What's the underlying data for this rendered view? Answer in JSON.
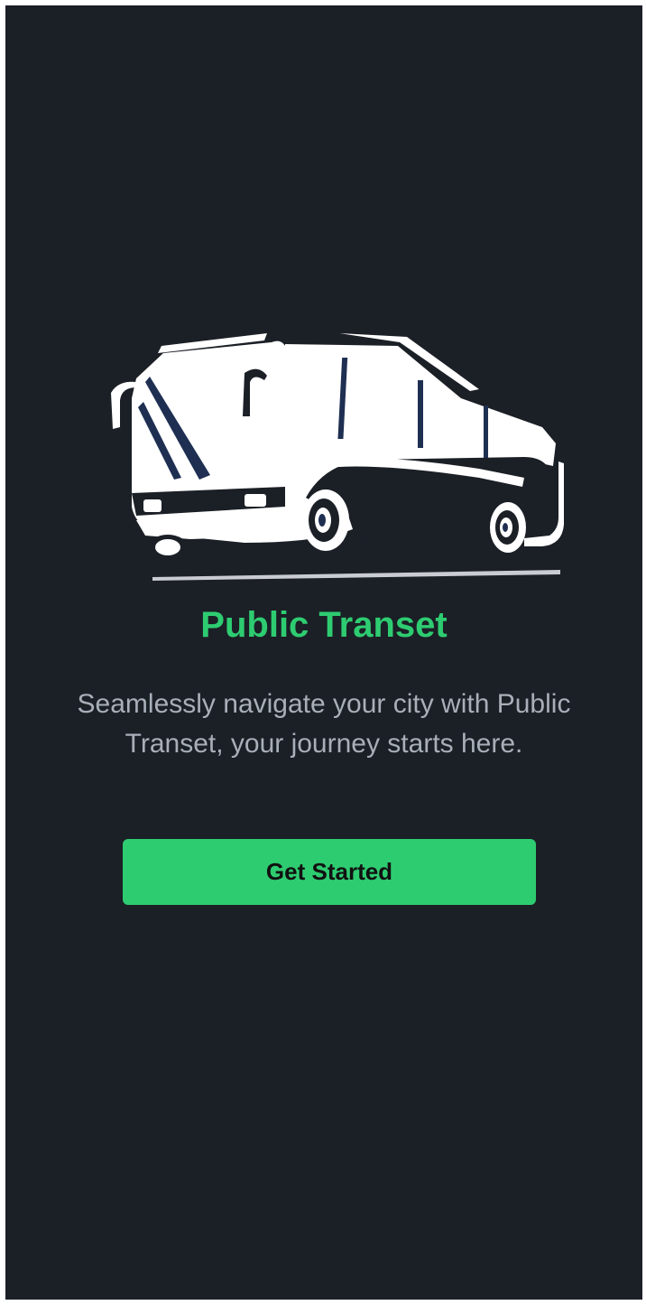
{
  "app": {
    "title": "Public Transet",
    "tagline": "Seamlessly navigate your city with Public Transet, your journey starts here.",
    "logo_icon": "bus-icon"
  },
  "actions": {
    "get_started_label": "Get Started"
  },
  "colors": {
    "background": "#1b1f26",
    "accent": "#2ecc71",
    "text_muted": "#a9afb8",
    "logo_fill": "#ffffff",
    "logo_detail": "#1e2f52"
  }
}
